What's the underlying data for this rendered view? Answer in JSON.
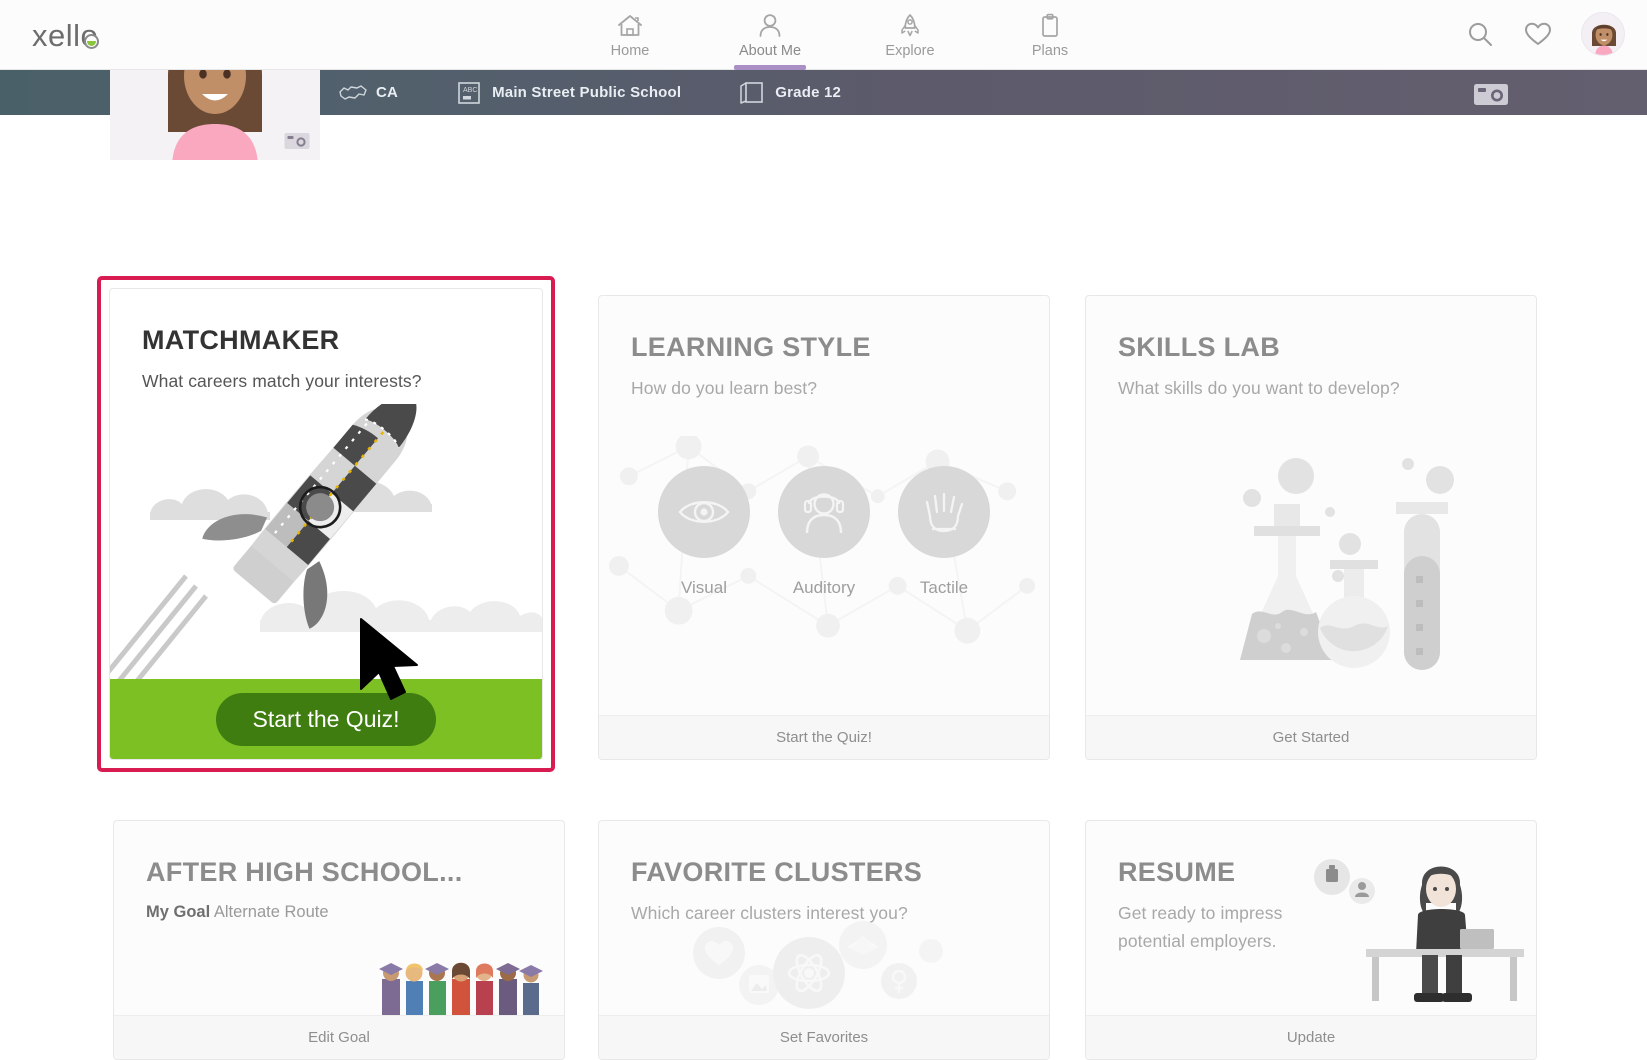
{
  "app": {
    "brand": "xello",
    "brand_accent": "#8cc63f"
  },
  "nav": {
    "items": [
      {
        "label": "Home",
        "icon": "home-icon",
        "active": false
      },
      {
        "label": "About Me",
        "icon": "person-icon",
        "active": true
      },
      {
        "label": "Explore",
        "icon": "rocket-icon",
        "active": false
      },
      {
        "label": "Plans",
        "icon": "clipboard-icon",
        "active": false
      }
    ],
    "active_indicator_color": "#a98fc4"
  },
  "header_actions": {
    "search": "search-icon",
    "favorites": "heart-icon",
    "avatar": "user-avatar"
  },
  "banner": {
    "country": "CA",
    "school": "Main Street Public School",
    "grade": "Grade 12",
    "camera": "camera-icon",
    "photo_camera": "camera-icon"
  },
  "highlight": {
    "color": "#d81b51",
    "target": "matchmaker-card"
  },
  "cards": {
    "matchmaker": {
      "title": "MATCHMAKER",
      "subtitle": "What careers match your interests?",
      "button_label": "Start the Quiz!",
      "button_bg": "#3f7d10",
      "footer_bg": "#7cc023",
      "illustration": "rocket-illustration"
    },
    "learning_style": {
      "title": "LEARNING STYLE",
      "subtitle": "How do you learn best?",
      "footer_label": "Start the Quiz!",
      "modes": [
        {
          "label": "Visual",
          "icon": "eye-icon"
        },
        {
          "label": "Auditory",
          "icon": "headphones-icon"
        },
        {
          "label": "Tactile",
          "icon": "hand-icon"
        }
      ]
    },
    "skills_lab": {
      "title": "SKILLS LAB",
      "subtitle": "What skills do you want to develop?",
      "footer_label": "Get Started",
      "illustration": "lab-flasks-illustration"
    },
    "after_high_school": {
      "title": "AFTER HIGH SCHOOL...",
      "goal_label": "My Goal",
      "goal_value": "Alternate Route",
      "footer_label": "Edit Goal",
      "illustration": "graduates-illustration"
    },
    "favorite_clusters": {
      "title": "FAVORITE CLUSTERS",
      "subtitle": "Which career clusters interest you?",
      "footer_label": "Set Favorites",
      "illustration": "cluster-icons-illustration"
    },
    "resume": {
      "title": "RESUME",
      "subtitle_line1": "Get ready to impress",
      "subtitle_line2": "potential employers.",
      "footer_label": "Update",
      "illustration": "desk-person-illustration"
    }
  }
}
